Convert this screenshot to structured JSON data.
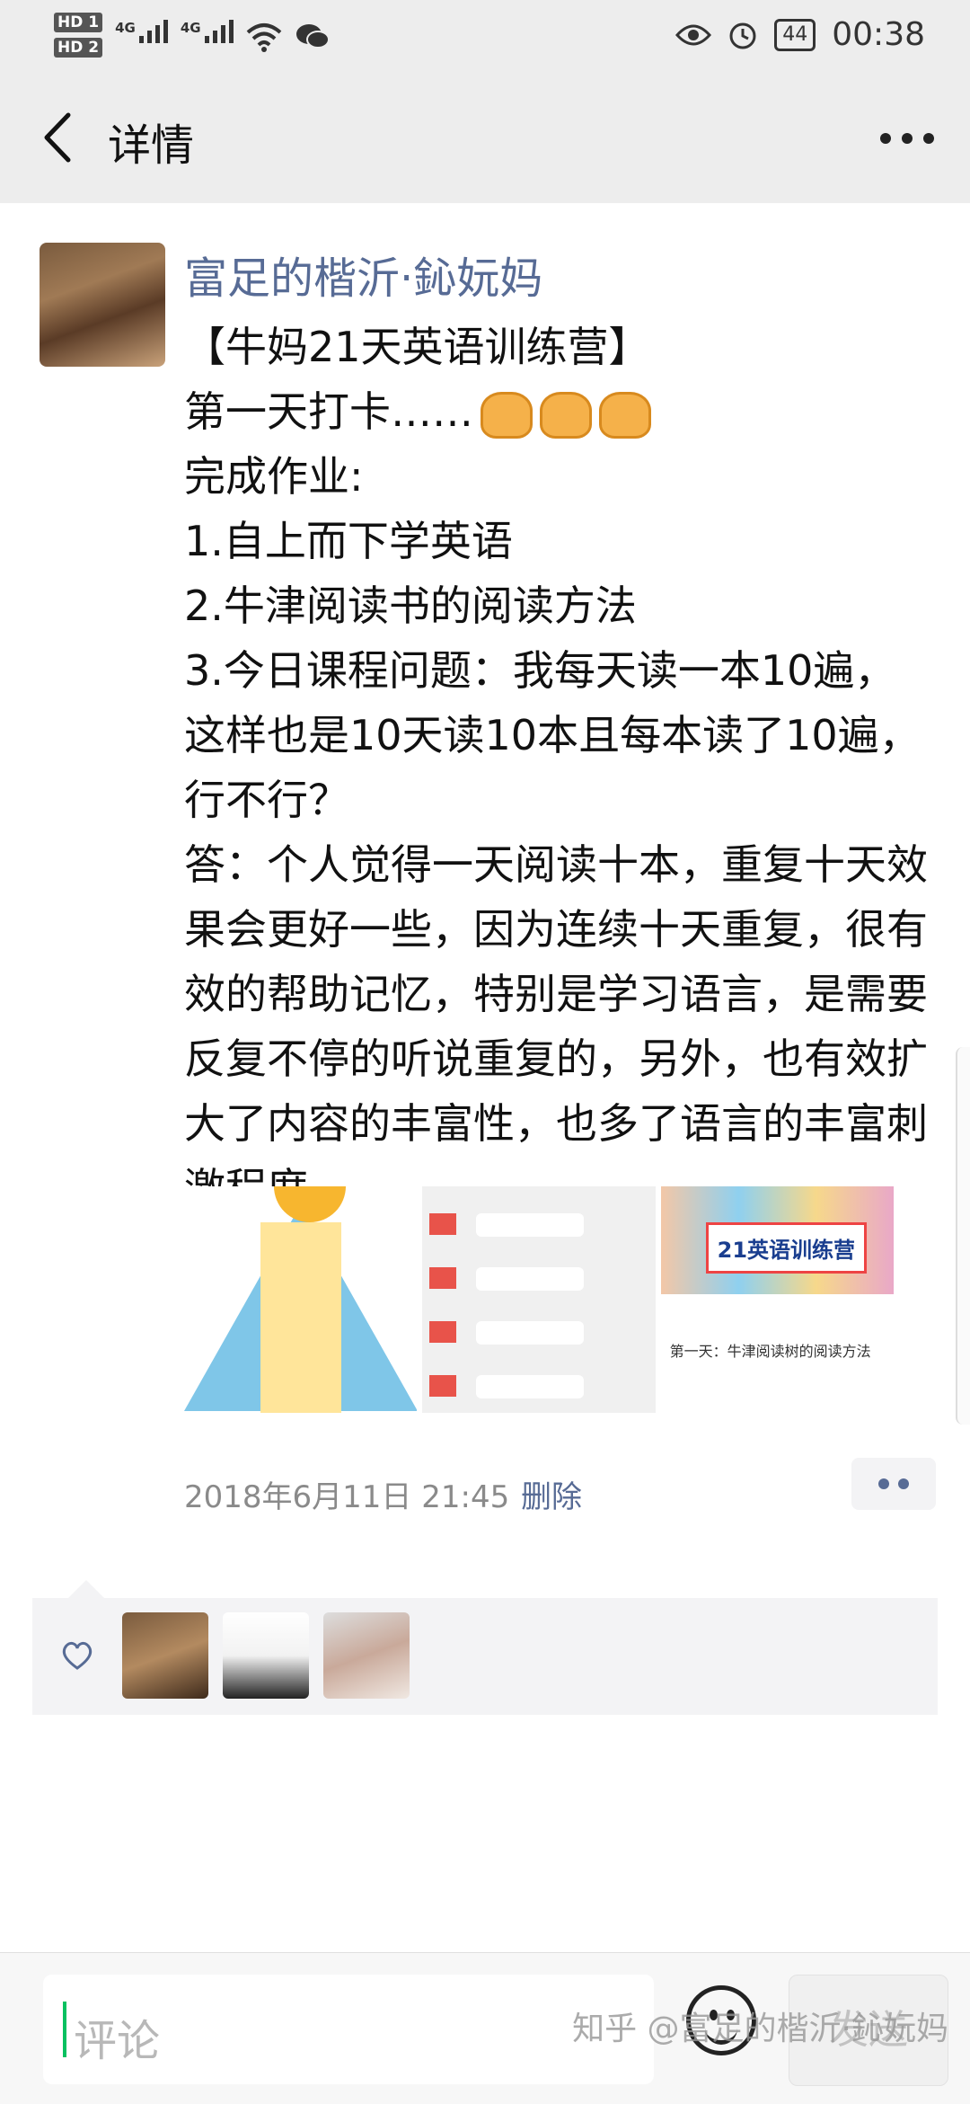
{
  "status_bar": {
    "hd1": "HD 1",
    "hd2": "HD 2",
    "network1": "4G",
    "network2": "4G",
    "battery": "44",
    "time": "00:38"
  },
  "nav": {
    "title": "详情"
  },
  "post": {
    "author": "富足的楷沂·鈊妧妈",
    "lines": [
      "【牛妈21天英语训练营】",
      "第一天打卡……",
      "完成作业:",
      "1.自上而下学英语",
      "2.牛津阅读书的阅读方法",
      "3.今日课程问题：我每天读一本10遍，这样也是10天读10本且每本读了10遍，行不行？",
      "答：个人觉得一天阅读十本，重复十天效果会更好一些，因为连续十天重复，很有效的帮助记忆，特别是学习语言，是需要反复不停的听说重复的，另外，也有效扩大了内容的丰富性，也多了语言的丰富刺激程度。"
    ],
    "photo3_title": "21英语训练营",
    "photo3_caption": "第一天：牛津阅读树的阅读方法",
    "timestamp": "2018年6月11日 21:45",
    "delete_label": "删除"
  },
  "likes": {
    "count": 3
  },
  "bottom": {
    "comment_placeholder": "评论",
    "send_label": "发送"
  },
  "watermark": "知乎 @富足的楷沂·鈊妧妈",
  "colors": {
    "link": "#576b95",
    "bar_bg": "#ededed",
    "cursor": "#07c160"
  }
}
